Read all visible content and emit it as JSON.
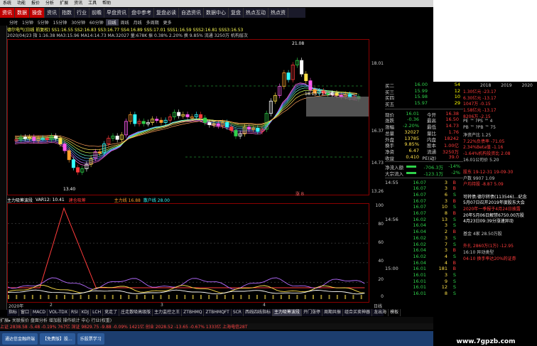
{
  "menubar": {
    "items": [
      "系统",
      "功能",
      "报价",
      "分析",
      "扩展",
      "资讯",
      "工具",
      "帮助"
    ],
    "right": "交易未登录  通达信"
  },
  "tabs": [
    {
      "label": "资讯",
      "active": true
    },
    {
      "label": "数据",
      "active": true
    },
    {
      "label": "操盘",
      "active": true
    },
    {
      "label": "资讯",
      "active": false
    },
    {
      "label": "指数",
      "active": false
    },
    {
      "label": "行业",
      "active": false
    },
    {
      "label": "前瞻",
      "active": false
    },
    {
      "label": "早盘资讯",
      "active": false
    },
    {
      "label": "盘中参考",
      "active": false
    },
    {
      "label": "复盘必读",
      "active": false
    },
    {
      "label": "自选资讯",
      "active": false
    },
    {
      "label": "数据中心",
      "active": false
    },
    {
      "label": "复盘",
      "active": false
    },
    {
      "label": "热点互动",
      "active": false
    },
    {
      "label": "热点资",
      "active": false
    }
  ],
  "periods": [
    "分时",
    "1分钟",
    "5分钟",
    "15分钟",
    "30分钟",
    "60分钟",
    "日线",
    "周线",
    "月线",
    "多周期",
    "更多"
  ],
  "active_period": "日线",
  "stock_line": "德尔电气(日线 前复权)  SS1:16.55  SS2:16.83  SS3:16.77  SS4:16.89  SSS:17.01  SSS1:16.59  SSS2:16.81  SSS3:16.53",
  "ma_line": "2020/04/23  指 1:16.38  MA3:15.96  MA14:14.73  MA:32027  量:678K  振 0.38%  2.20%  换 9.85%  流通 3250万  机构层次",
  "annotations": {
    "high": "21.08",
    "low": "13.40",
    "range": "18.15 - 17.28",
    "mark": "涨 B"
  },
  "main_y_ticks": [
    "18.01",
    "16.37",
    "14.73",
    "13.26"
  ],
  "sub_title": {
    "name": "主力吸筹波段",
    "var": "VAR12: 10.41",
    "l1": "建仓吸筹",
    "l2": "主力线 16.88",
    "l3": "散户线 28.00"
  },
  "sub_y_ticks": [
    "100",
    "80",
    "60",
    "40",
    "20",
    "0"
  ],
  "dates": [
    "2020年",
    "2",
    "3",
    "4",
    "日线"
  ],
  "indicator_tabs": [
    {
      "label": "指标",
      "active": false
    },
    {
      "label": "窗口",
      "active": false
    },
    {
      "label": "MACD",
      "active": false
    },
    {
      "label": "VOL-TDX",
      "active": false
    },
    {
      "label": "RSI",
      "active": false
    },
    {
      "label": "KDJ",
      "active": false
    },
    {
      "label": "LCH",
      "active": false
    },
    {
      "label": "竞走了",
      "active": false
    },
    {
      "label": "庄走散吸高级版",
      "active": false
    },
    {
      "label": "主力监控之王",
      "active": false
    },
    {
      "label": "ZTBHMQ",
      "active": false
    },
    {
      "label": "ZTBHMQFT",
      "active": false
    },
    {
      "label": "SCR",
      "active": false
    },
    {
      "label": "西线四线指标",
      "active": false
    },
    {
      "label": "主力吸筹波段",
      "active": true
    },
    {
      "label": "开门涨停",
      "active": false
    },
    {
      "label": "周期共振",
      "active": false
    },
    {
      "label": "组合买卖神器",
      "active": false
    },
    {
      "label": "龙出海",
      "active": false
    },
    {
      "label": "模板",
      "active": false
    }
  ],
  "status1": "扩展▸  关联报价  盘面分析  增加股  操作统计  中心  行业(权重)",
  "status2": "上证 2838.58  -5.48  -0.19%  767亿  深证 9829.75  -9.88  -0.09%  1421亿  创业 2028.52  -13.65  -0.67%  1333亿   上海电信28T",
  "taskbar": [
    "通达信金融终端",
    "【免费版】股...",
    "乐股票学习"
  ],
  "watermark": "www.7gpzb.com",
  "orderbook": [
    {
      "label": "买二",
      "price": "16.00",
      "vol": "54"
    },
    {
      "label": "买三",
      "price": "15.99",
      "vol": "12"
    },
    {
      "label": "买四",
      "price": "15.98",
      "vol": "10"
    },
    {
      "label": "买五",
      "price": "15.97",
      "vol": "29"
    }
  ],
  "quote": [
    {
      "l": "现价",
      "v": "16.01",
      "l2": "今开",
      "v2": "16.38"
    },
    {
      "l": "涨跌",
      "v": "-0.36",
      "l2": "最高",
      "v2": "16.50"
    },
    {
      "l": "涨幅",
      "v": "-2.20%",
      "l2": "最低",
      "v2": "14.73"
    },
    {
      "l": "总量",
      "v": "32027",
      "l2": "量比",
      "v2": "1.76"
    },
    {
      "l": "外盘",
      "v": "13785",
      "l2": "内盘",
      "v2": "18242"
    },
    {
      "l": "换手",
      "v": "9.85%",
      "l2": "股本",
      "v2": "1.00亿"
    },
    {
      "l": "净资",
      "v": "6.47",
      "l2": "流通",
      "v2": "3250万"
    },
    {
      "l": "收益",
      "v": "0.410",
      "l2": "PE(动)",
      "v2": "39.0"
    }
  ],
  "flow": [
    {
      "l": "净流入额",
      "v": "-706.3万",
      "p": "-14%"
    },
    {
      "l": "大宗流入",
      "v": "-123.1万",
      "p": "-2%"
    }
  ],
  "ticks": [
    {
      "t": "14:55",
      "p": "16.07",
      "v": "3",
      "s": "B"
    },
    {
      "t": "",
      "p": "16.07",
      "v": "3",
      "s": "B"
    },
    {
      "t": "",
      "p": "16.07",
      "v": "6",
      "s": "S"
    },
    {
      "t": "",
      "p": "16.07",
      "v": "3",
      "s": "B"
    },
    {
      "t": "",
      "p": "16.07",
      "v": "10",
      "s": "S"
    },
    {
      "t": "",
      "p": "16.07",
      "v": "8",
      "s": "B"
    },
    {
      "t": "14:56",
      "p": "16.02",
      "v": "13",
      "s": "S"
    },
    {
      "t": "",
      "p": "16.04",
      "v": "3",
      "s": "S"
    },
    {
      "t": "",
      "p": "16.04",
      "v": "2",
      "s": "B"
    },
    {
      "t": "",
      "p": "16.02",
      "v": "3",
      "s": "S"
    },
    {
      "t": "",
      "p": "16.02",
      "v": "7",
      "s": "S"
    },
    {
      "t": "",
      "p": "16.04",
      "v": "3",
      "s": "B"
    },
    {
      "t": "",
      "p": "16.02",
      "v": "4",
      "s": "S"
    },
    {
      "t": "",
      "p": "16.04",
      "v": "4",
      "s": "B"
    },
    {
      "t": "15:00",
      "p": "16.01",
      "v": "181",
      "s": "B"
    },
    {
      "t": "",
      "p": "16.01",
      "v": "3",
      "s": "S"
    },
    {
      "t": "",
      "p": "16.01",
      "v": "9",
      "s": "S"
    },
    {
      "t": "",
      "p": "16.01",
      "v": "12",
      "s": "S"
    },
    {
      "t": "",
      "p": "16.01",
      "v": "8",
      "s": "S"
    }
  ],
  "far_right_years": [
    "2018",
    "2019",
    "2020"
  ],
  "far_right": [
    "1.30亿元  -23.17",
    "6.30亿元  -13.17",
    "1047万  -0.15",
    "1.58亿元  -13.17",
    "8206万  -2.15",
    "PE ™  ?PS ™  4",
    "PB ™  ?PB ™  75",
    "净资产比  1.25",
    "7.22%负债率  -71.05",
    "2.34%Beta值  -1.16",
    "-1.64%机构投资比  2.08",
    "16.01公司价  5.20",
    "",
    "股东  19-12-31  19-09-30",
    "户数  9907  1.09",
    "户均持股  -8.87  5.09",
    "",
    "可转债:德尔转债(113546)…纪念",
    "5月07日召开2019年度股东大会",
    "2020年一季报于4月24日披露",
    "20年5月06日解禁6750.00万股",
    "4月23日09:39分涨速异动",
    "",
    "基金  4家  28.50万股",
    "",
    "外扎  2860万(1万)  -12.95",
    "16:10  异动类型",
    "04-10  换手率达20%的证券"
  ]
}
